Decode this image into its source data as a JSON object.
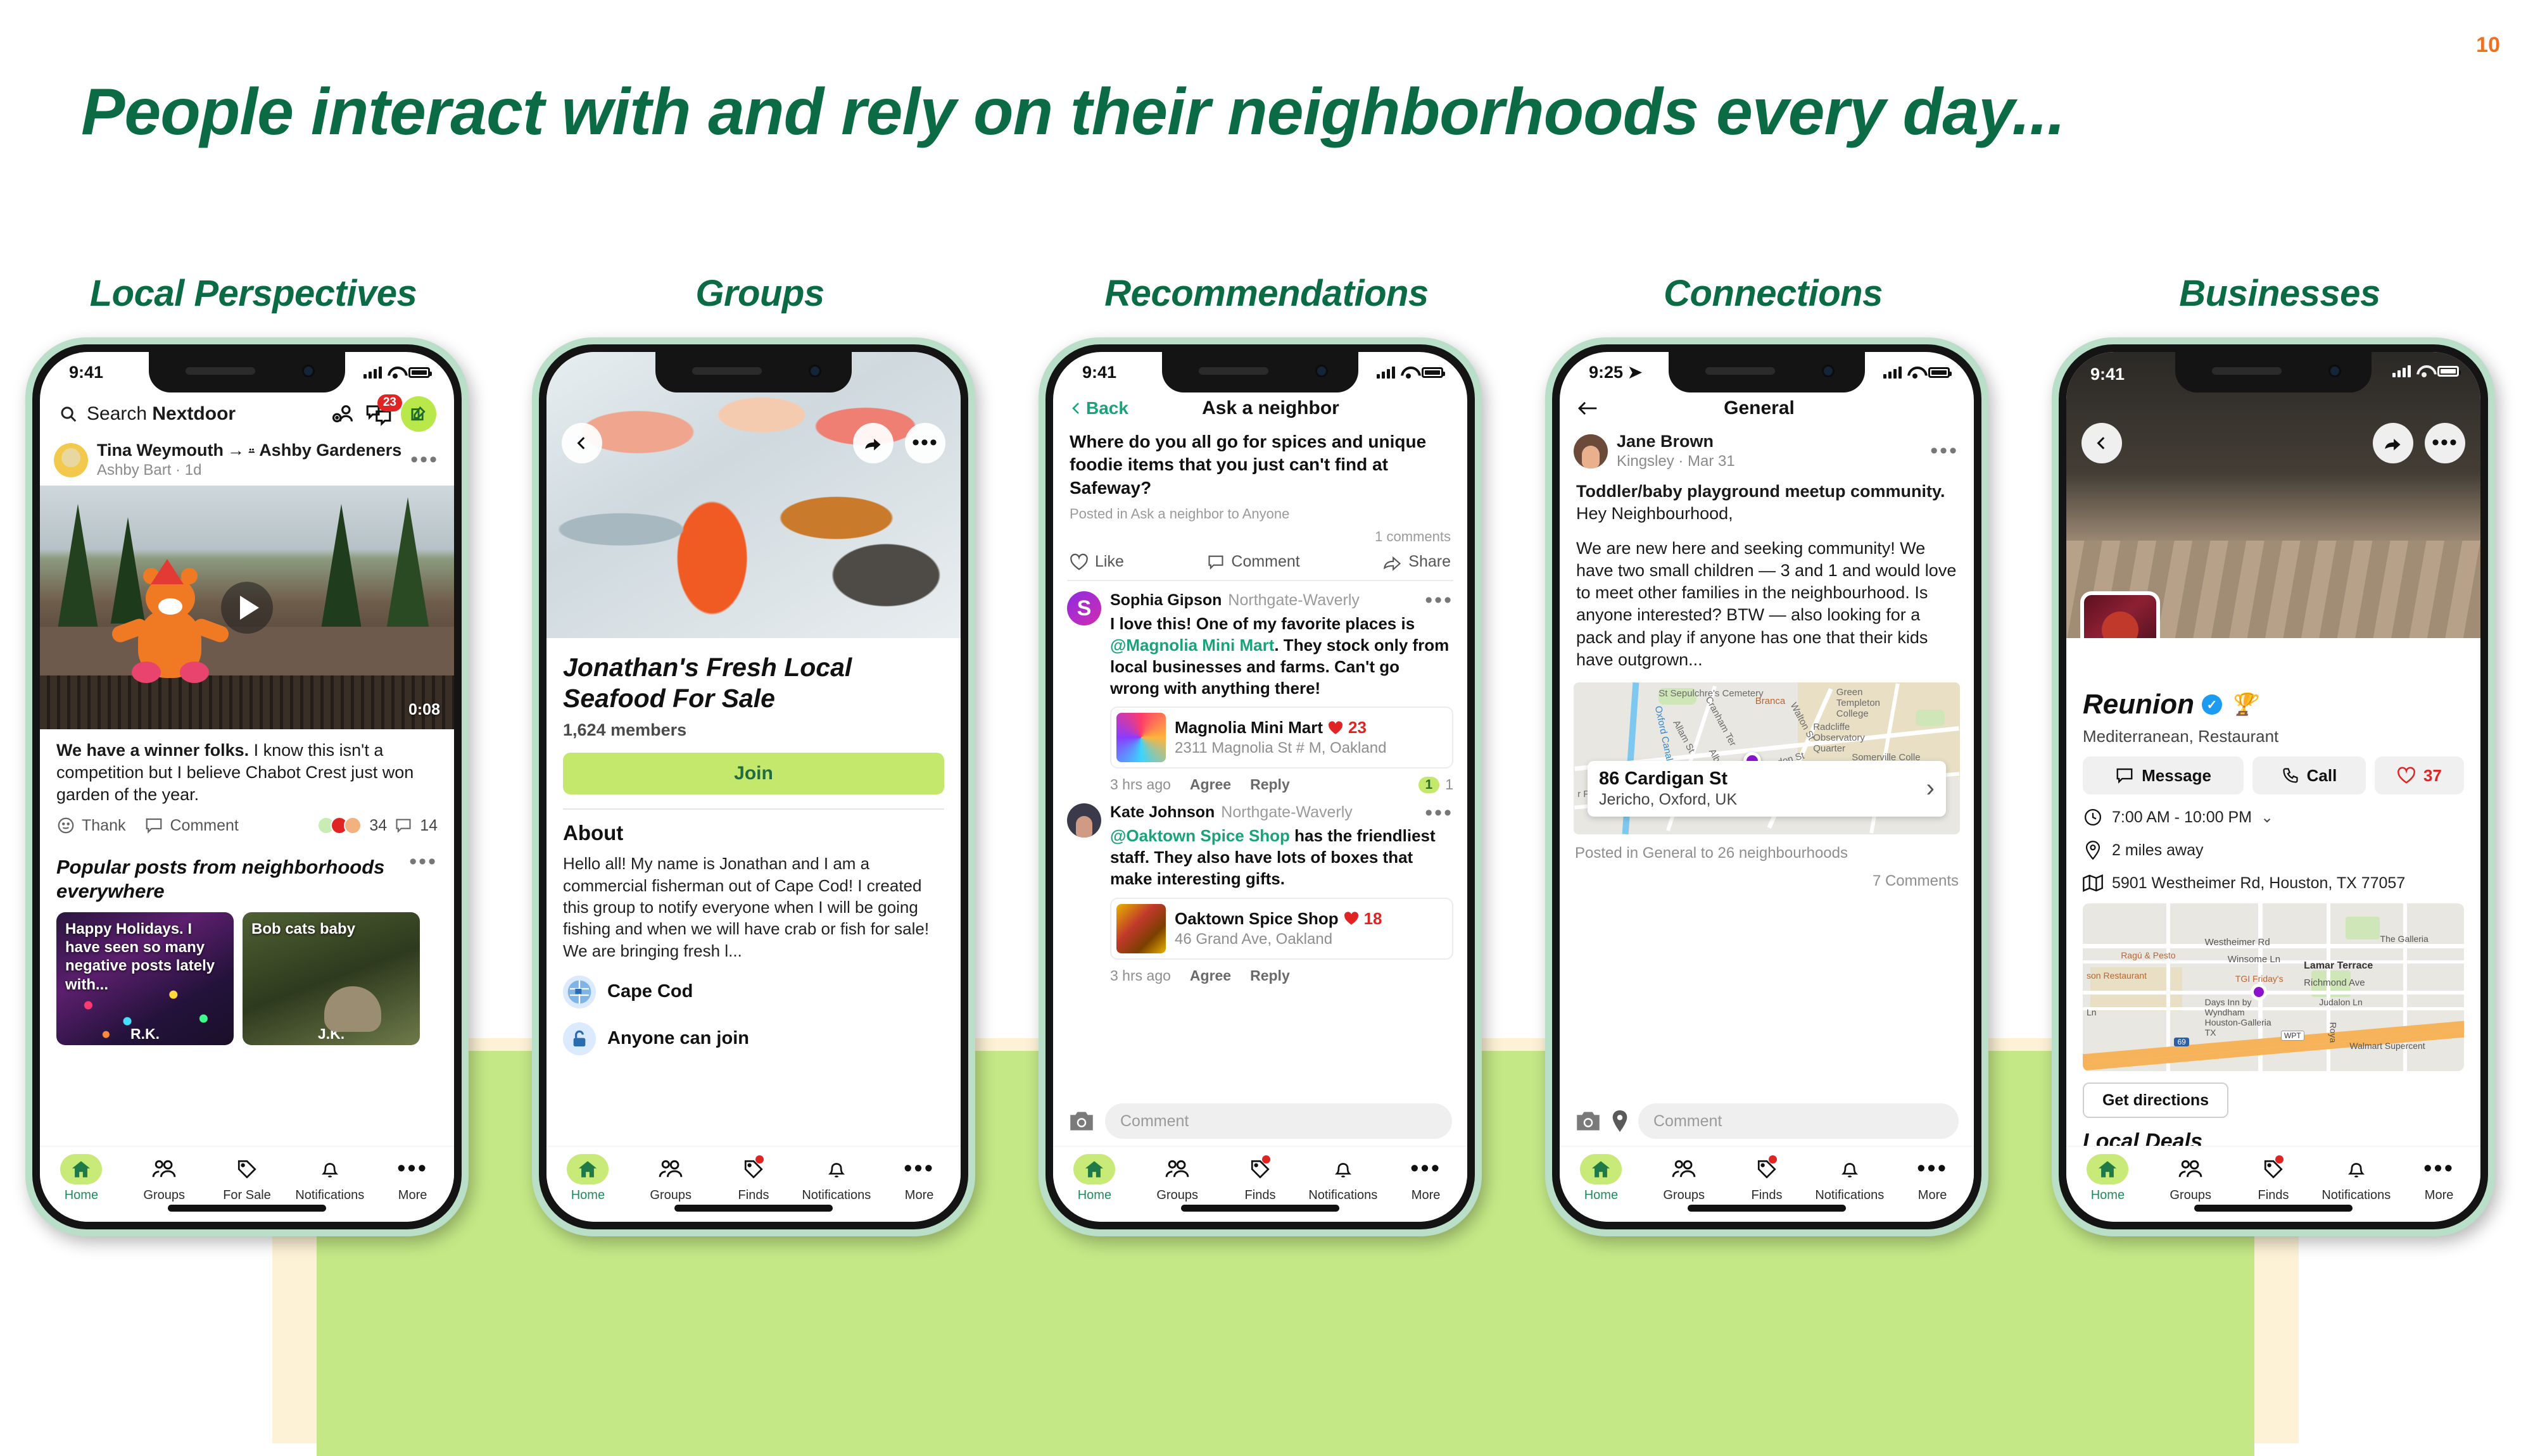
{
  "page_number": "10",
  "title": "People interact with and rely on their neighborhoods every day...",
  "colors": {
    "title_green": "#0a6b45",
    "page_number_orange": "#f07020",
    "accent_lime": "#c3e86c",
    "brand_green": "#1f8a5c"
  },
  "columns": [
    {
      "heading": "Local Perspectives",
      "phone": {
        "status": {
          "time": "9:41"
        },
        "topbar": {
          "search_placeholder": "Search Nextdoor",
          "search_prefix": "Search ",
          "search_brand": "Nextdoor",
          "invite_icon": "add-person-icon",
          "messages_icon": "chat-bubbles-icon",
          "messages_badge": "23",
          "compose_icon": "compose-pencil-icon"
        },
        "post": {
          "author": "Tina Weymouth",
          "arrow": "→",
          "group": "Ashby Gardeners",
          "subtitle": "Ashby Bart · 1d",
          "video_duration": "0:08",
          "body_bold": "We have a winner folks.",
          "body_rest": " I know this isn't a competition but I believe Chabot Crest just won garden of the year.",
          "actions": {
            "thank": "Thank",
            "comment": "Comment"
          },
          "reaction_count": "34",
          "comment_count": "14"
        },
        "section": {
          "title": "Popular posts from neighborhoods everywhere"
        },
        "cards": [
          {
            "text": "Happy Holidays. I have seen so many negative posts lately with...",
            "initials": "R.K."
          },
          {
            "text": "Bob cats baby",
            "initials": "J.K."
          }
        ],
        "tabs": [
          {
            "label": "Home",
            "icon": "home-icon",
            "active": true
          },
          {
            "label": "Groups",
            "icon": "people-icon",
            "active": false
          },
          {
            "label": "For Sale",
            "icon": "tag-icon",
            "active": false
          },
          {
            "label": "Notifications",
            "icon": "bell-icon",
            "active": false
          },
          {
            "label": "More",
            "icon": "ellipsis-icon",
            "active": false
          }
        ]
      }
    },
    {
      "heading": "Groups",
      "phone": {
        "hero_buttons": {
          "back": "back-chevron-icon",
          "share": "share-arrow-icon",
          "more": "ellipsis-icon"
        },
        "group_title": "Jonathan's Fresh Local Seafood For Sale",
        "members": "1,624 members",
        "join_label": "Join",
        "about_heading": "About",
        "about_text": "Hello all! My name is Jonathan and I am a commercial fisherman out of Cape Cod! I created this group to notify everyone when I will be going fishing and when we will have crab or fish for sale! We are bringing fresh l...",
        "meta": [
          {
            "label": "Cape Cod",
            "icon": "map-globe-icon"
          },
          {
            "label": "Anyone can join",
            "icon": "unlock-icon"
          }
        ],
        "tabs": [
          {
            "label": "Home",
            "icon": "home-icon",
            "active": true
          },
          {
            "label": "Groups",
            "icon": "people-icon",
            "active": false
          },
          {
            "label": "Finds",
            "icon": "tag-icon",
            "active": false
          },
          {
            "label": "Notifications",
            "icon": "bell-icon",
            "active": false
          },
          {
            "label": "More",
            "icon": "ellipsis-icon",
            "active": false
          }
        ]
      }
    },
    {
      "heading": "Recommendations",
      "phone": {
        "status": {
          "time": "9:41"
        },
        "navbar": {
          "back": "Back",
          "title": "Ask a neighbor"
        },
        "question": "Where do you all go for spices and unique foodie items that  you just can't find at Safeway?",
        "posted_in": "Posted in Ask a neighbor to Anyone",
        "comments_count": "1 comments",
        "actions": {
          "like": "Like",
          "comment": "Comment",
          "share": "Share"
        },
        "comments": [
          {
            "name": "Sophia Gipson",
            "hood": "Northgate-Waverly",
            "mention": "@Magnolia Mini Mart",
            "text_before": "I love this! One of my favorite places is ",
            "text_after": ". They stock only from local businesses and farms. Can't go wrong with anything there!",
            "business": {
              "name": "Magnolia Mini Mart",
              "likes": "23",
              "address": "2311 Magnolia St # M, Oakland"
            },
            "time": "3 hrs ago",
            "agree": "Agree",
            "reply": "Reply",
            "upvote_chip": "1",
            "upvote_count": "1"
          },
          {
            "name": "Kate Johnson",
            "hood": "Northgate-Waverly",
            "mention": "@Oaktown Spice Shop",
            "text_before": "",
            "text_after": " has the friendliest staff. They also have lots of boxes that make interesting gifts.",
            "business": {
              "name": "Oaktown Spice Shop",
              "likes": "18",
              "address": "46 Grand Ave, Oakland"
            },
            "time": "3 hrs ago",
            "agree": "Agree",
            "reply": "Reply"
          }
        ],
        "comment_input": {
          "placeholder": "Comment",
          "camera_icon": "camera-icon"
        },
        "tabs": [
          {
            "label": "Home",
            "icon": "home-icon",
            "active": true
          },
          {
            "label": "Groups",
            "icon": "people-icon",
            "active": false
          },
          {
            "label": "Finds",
            "icon": "tag-icon",
            "active": false
          },
          {
            "label": "Notifications",
            "icon": "bell-icon",
            "active": false
          },
          {
            "label": "More",
            "icon": "ellipsis-icon",
            "active": false
          }
        ]
      }
    },
    {
      "heading": "Connections",
      "phone": {
        "status": {
          "time": "9:25"
        },
        "navbar": {
          "title": "General"
        },
        "post": {
          "author": "Jane Brown",
          "subtitle": "Kingsley · Mar 31",
          "body_bold": "Toddler/baby playground meetup community.",
          "body_rest": " Hey Neighbourhood,",
          "body_paragraph": "We are new here and seeking community! We have two small children — 3 and 1 and would love to meet other families in the neighbourhood. Is anyone interested? BTW — also looking for a pack and play if anyone has one that their kids have outgrown..."
        },
        "map": {
          "labels": [
            "St Sepulchre's Cemetery",
            "Branca",
            "Cranham Ter",
            "Allam St",
            "Oxford Canal",
            "Walton St",
            "Radcliffe Observatory Quarter",
            "Green Templeton College",
            "Somerville Colle",
            "Albert",
            "endon St",
            "r Park"
          ],
          "card_title": "86 Cardigan St",
          "card_sub": "Jericho, Oxford, UK"
        },
        "posted_in": "Posted in General to 26 neighbourhoods",
        "comments_count": "7 Comments",
        "comment_input": {
          "placeholder": "Comment",
          "camera_icon": "camera-icon",
          "pin_icon": "map-pin-icon"
        },
        "tabs": [
          {
            "label": "Home",
            "icon": "home-icon",
            "active": true
          },
          {
            "label": "Groups",
            "icon": "people-icon",
            "active": false
          },
          {
            "label": "Finds",
            "icon": "tag-icon",
            "active": false
          },
          {
            "label": "Notifications",
            "icon": "bell-icon",
            "active": false
          },
          {
            "label": "More",
            "icon": "ellipsis-icon",
            "active": false
          }
        ]
      }
    },
    {
      "heading": "Businesses",
      "phone": {
        "status": {
          "time": "9:41"
        },
        "hero_buttons": {
          "back": "back-chevron-icon",
          "share": "share-arrow-icon",
          "more": "ellipsis-icon"
        },
        "business": {
          "name": "Reunion",
          "verified_icon": "verified-badge-icon",
          "award_icon": "trophy-icon",
          "category": "Mediterranean, Restaurant",
          "buttons": {
            "message": "Message",
            "call": "Call",
            "likes": "37"
          },
          "hours": "7:00 AM - 10:00 PM",
          "distance": "2 miles away",
          "address": "5901 Westheimer Rd, Houston, TX 77057",
          "get_directions": "Get directions",
          "local_deals": "Local Deals"
        },
        "map": {
          "labels": [
            "Westheimer Rd",
            "Winsome Ln",
            "Lamar Terrace",
            "Richmond Ave",
            "TGI Friday's",
            "Ragú & Pesto",
            "son Restaurant",
            "Days Inn by Wyndham Houston-Galleria TX",
            "Judalon Ln",
            "The Galleria",
            "Walmart Supercent",
            "Ln",
            "Roya",
            "WPT",
            "69"
          ]
        },
        "tabs": [
          {
            "label": "Home",
            "icon": "home-icon",
            "active": true
          },
          {
            "label": "Groups",
            "icon": "people-icon",
            "active": false
          },
          {
            "label": "Finds",
            "icon": "tag-icon",
            "active": false
          },
          {
            "label": "Notifications",
            "icon": "bell-icon",
            "active": false
          },
          {
            "label": "More",
            "icon": "ellipsis-icon",
            "active": false
          }
        ]
      }
    }
  ]
}
